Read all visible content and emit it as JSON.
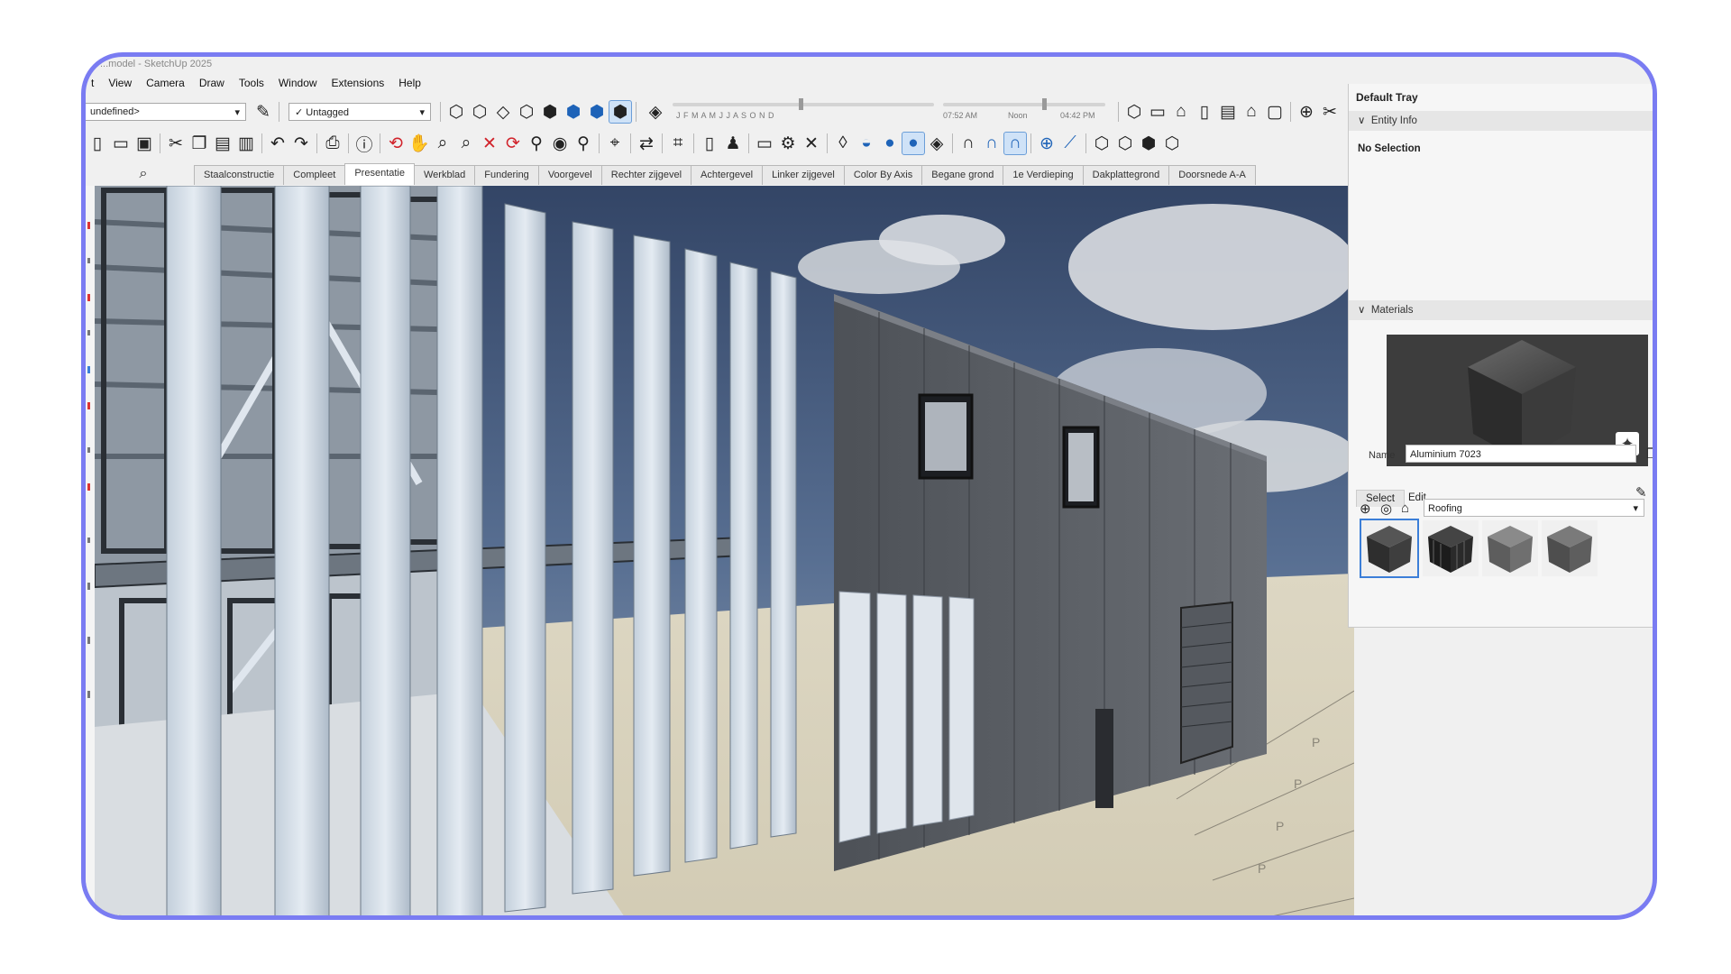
{
  "window": {
    "title": "...model - SketchUp 2025"
  },
  "menu": [
    "t",
    "View",
    "Camera",
    "Draw",
    "Tools",
    "Window",
    "Extensions",
    "Help"
  ],
  "toolbar": {
    "layer_select": "undefined>",
    "tag_select": "Untagged",
    "months": "J  F  M  A  M  J  J  A  S  O  N  D",
    "time_start": "07:52 AM",
    "time_noon": "Noon",
    "time_end": "04:42 PM"
  },
  "scene_tabs": [
    "Staalconstructie",
    "Compleet",
    "Presentatie",
    "Werkblad",
    "Fundering",
    "Voorgevel",
    "Rechter zijgevel",
    "Achtergevel",
    "Linker zijgevel",
    "Color By Axis",
    "Begane grond",
    "1e Verdieping",
    "Dakplattegrond",
    "Doorsnede A-A"
  ],
  "active_tab": "Presentatie",
  "tray": {
    "title": "Default Tray",
    "entity_info": {
      "header": "Entity Info",
      "selection": "No Selection"
    },
    "materials": {
      "header": "Materials",
      "name_label": "Name",
      "name_value": "Aluminium 7023",
      "tab_select": "Select",
      "tab_edit": "Edit",
      "category": "Roofing",
      "swatch_colors": [
        "#3c3c3c",
        "#262626",
        "#6d6d6d",
        "#5a5a5a"
      ]
    }
  }
}
